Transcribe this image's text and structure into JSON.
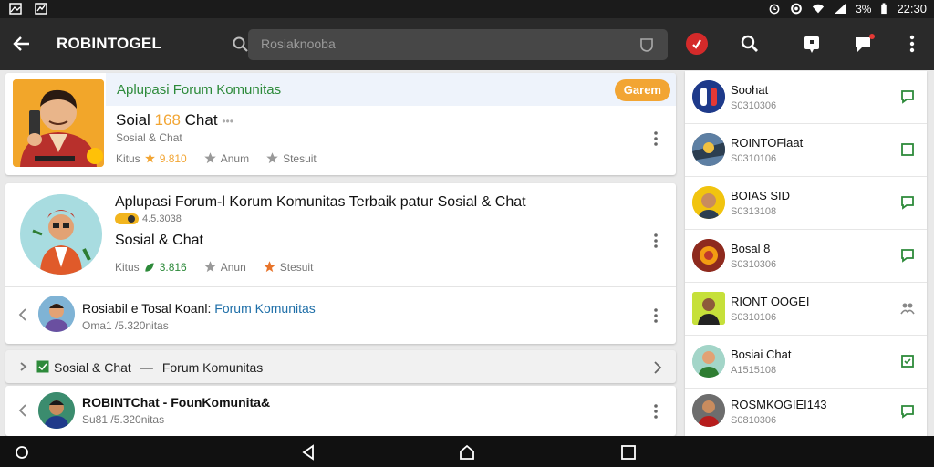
{
  "status": {
    "battery": "3%",
    "time": "22:30"
  },
  "appbar": {
    "title": "ROBINTOGEL",
    "search_placeholder": "Rosiaknooba"
  },
  "colors": {
    "accent_green": "#2d8a3a",
    "orange": "#f2a533",
    "red": "#d42a2a",
    "appbar": "#2a2a2a"
  },
  "icons": {
    "back": "arrow-left",
    "search": "magnifier",
    "chat": "chat-bubble",
    "menu": "vertical-dots"
  },
  "card1": {
    "header": "Aplupasi Forum Komunitas",
    "badge": "Garem",
    "title_prefix": "Soial",
    "title_highlight": "168",
    "title_suffix": "Chat",
    "title_dots": "•••",
    "subtitle": "Sosial & Chat",
    "stats": [
      {
        "label": "Kitus",
        "icon": "star",
        "value": "9.810"
      },
      {
        "label": "Anum",
        "icon": "star",
        "value": ""
      },
      {
        "label": "Stesuit",
        "icon": "star",
        "value": ""
      }
    ]
  },
  "card2": {
    "title": "Aplupasi Forum-l Korum Komunitas Terbaik patur Sosial & Chat",
    "rating_value": "4.5.3038",
    "category": "Sosial & Chat",
    "stats": [
      {
        "label": "Kitus",
        "icon": "leaf",
        "value": "3.816"
      },
      {
        "label": "Anun",
        "icon": "star",
        "value": ""
      },
      {
        "label": "Stesuit",
        "icon": "star",
        "value": ""
      }
    ],
    "sub": {
      "title_a": "Rosiabil e Tosal Koanl:",
      "title_b": "Forum Komunitas",
      "meta": "Oma1 /5.320nitas"
    }
  },
  "card3": {
    "label": "Sosial & Chat",
    "dash": "—",
    "link": "Forum Komunitas"
  },
  "card4": {
    "title": "ROBINTChat - FounKomunita&",
    "meta": "Su81 /5.320nitas"
  },
  "sidebar": {
    "items": [
      {
        "name": "Soohat",
        "number": "S0310306"
      },
      {
        "name": "ROINTOFlaat",
        "number": "S0310106"
      },
      {
        "name": "BOIAS SID",
        "number": "S0313108"
      },
      {
        "name": "Bosal 8",
        "number": "S0310306"
      },
      {
        "name": "RIONT OOGEI",
        "number": "S0310106"
      },
      {
        "name": "Bosiai Chat",
        "number": "A1515108"
      },
      {
        "name": "ROSMKOGIEI143",
        "number": "S0810306"
      }
    ]
  }
}
